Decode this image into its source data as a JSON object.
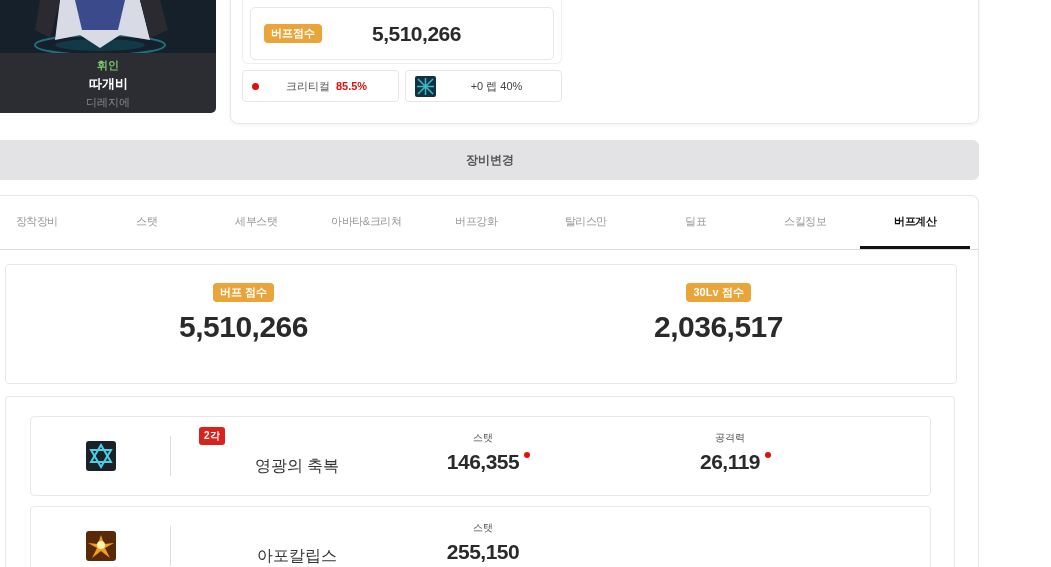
{
  "character": {
    "job": "휘인",
    "name": "따개비",
    "server": "디레지에"
  },
  "summary": {
    "badge": "버프점수",
    "score": "5,510,266",
    "critical_label": "크리티컬",
    "critical_value": "85.5%",
    "item_text": "+0 렙 40%"
  },
  "equip_button": "장비변경",
  "tabs": [
    {
      "label": "장착장비",
      "selected": false
    },
    {
      "label": "스탯",
      "selected": false
    },
    {
      "label": "세부스탯",
      "selected": false
    },
    {
      "label": "아바타&크리쳐",
      "selected": false
    },
    {
      "label": "버프강화",
      "selected": false
    },
    {
      "label": "탈리스만",
      "selected": false
    },
    {
      "label": "딜표",
      "selected": false
    },
    {
      "label": "스킬정보",
      "selected": false
    },
    {
      "label": "버프계산",
      "selected": true
    }
  ],
  "scores": [
    {
      "badge": "버프 점수",
      "value": "5,510,266"
    },
    {
      "badge": "30Lv 점수",
      "value": "2,036,517"
    }
  ],
  "skills": [
    {
      "name": "영광의 축복",
      "tag": "2각",
      "kind": "star",
      "stats": [
        {
          "label": "스탯",
          "value": "146,355",
          "marked": true
        },
        {
          "label": "공격력",
          "value": "26,119",
          "marked": true
        }
      ]
    },
    {
      "name": "아포칼립스",
      "kind": "burst",
      "stats": [
        {
          "label": "스탯",
          "value": "255,150",
          "marked": false
        }
      ]
    }
  ]
}
